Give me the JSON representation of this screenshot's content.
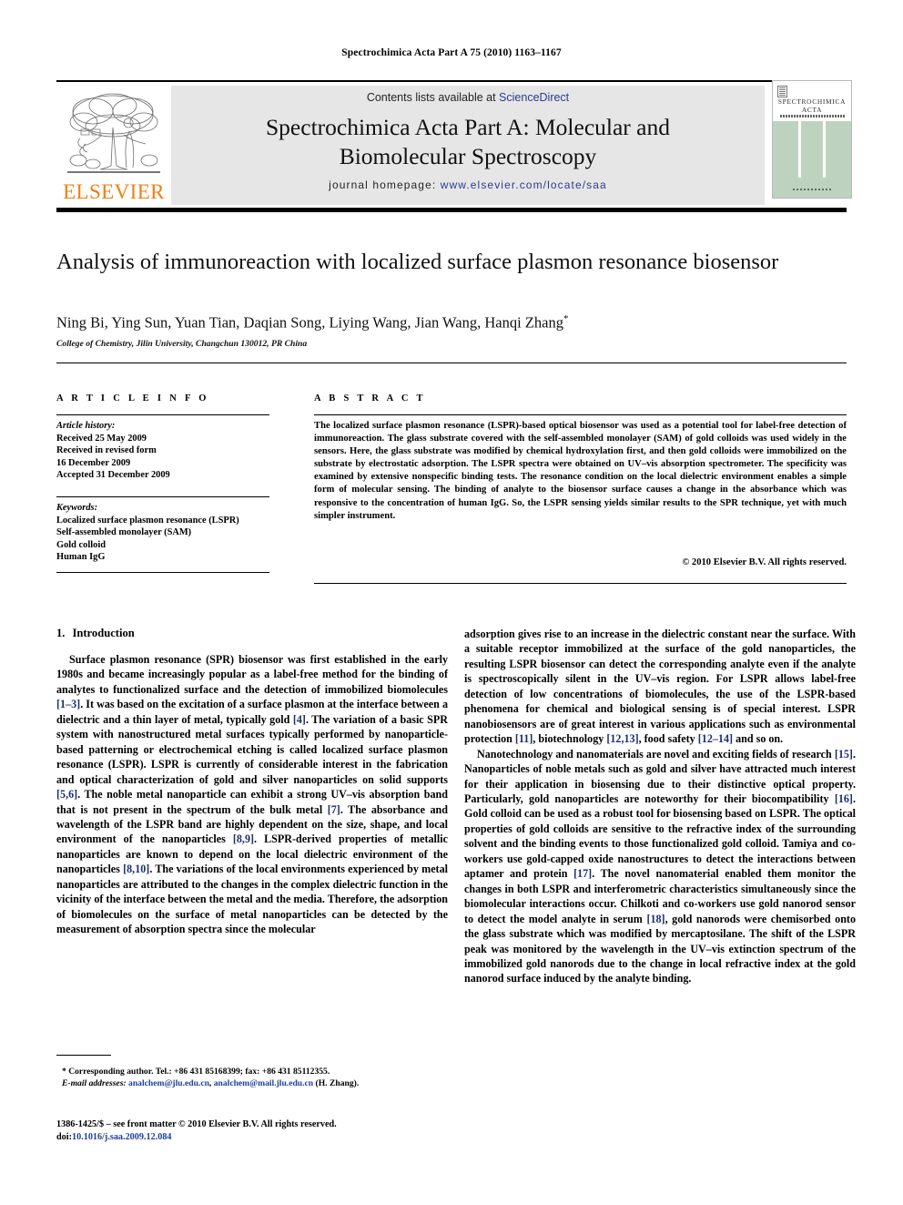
{
  "running_head": "Spectrochimica Acta Part A 75 (2010) 1163–1167",
  "masthead": {
    "contents_prefix": "Contents lists available at ",
    "contents_link": "ScienceDirect",
    "journal_title_line1": "Spectrochimica Acta Part A: Molecular and",
    "journal_title_line2": "Biomolecular Spectroscopy",
    "homepage_prefix": "journal homepage: ",
    "homepage_url": "www.elsevier.com/locate/saa",
    "publisher_logo_text": "ELSEVIER",
    "publisher_logo_icon": "elsevier-tree-icon",
    "accent_orange": "#f07f13",
    "link_blue": "#2a3b8f",
    "band_gray": "#e6e6e6"
  },
  "cover": {
    "title_line1": "SPECTROCHIMICA",
    "title_line2": "ACTA",
    "body_color": "#bed3bf"
  },
  "article": {
    "title": "Analysis of immunoreaction with localized surface plasmon resonance biosensor",
    "authors": "Ning Bi, Ying Sun, Yuan Tian, Daqian Song, Liying Wang, Jian Wang, Hanqi Zhang",
    "corresponding_marker": "*",
    "affiliation": "College of Chemistry, Jilin University, Changchun 130012, PR China"
  },
  "article_info": {
    "heading": "A R T I C L E   I N F O",
    "history_label": "Article history:",
    "history": [
      "Received 25 May 2009",
      "Received in revised form",
      "16 December 2009",
      "Accepted 31 December 2009"
    ],
    "keywords_label": "Keywords:",
    "keywords": [
      "Localized surface plasmon resonance (LSPR)",
      "Self-assembled monolayer (SAM)",
      "Gold colloid",
      "Human IgG"
    ]
  },
  "abstract": {
    "heading": "A B S T R A C T",
    "text": "The localized surface plasmon resonance (LSPR)-based optical biosensor was used as a potential tool for label-free detection of immunoreaction. The glass substrate covered with the self-assembled monolayer (SAM) of gold colloids was used widely in the sensors. Here, the glass substrate was modified by chemical hydroxylation first, and then gold colloids were immobilized on the substrate by electrostatic adsorption. The LSPR spectra were obtained on UV–vis absorption spectrometer. The specificity was examined by extensive nonspecific binding tests. The resonance condition on the local dielectric environment enables a simple form of molecular sensing. The binding of analyte to the biosensor surface causes a change in the absorbance which was responsive to the concentration of human IgG. So, the LSPR sensing yields similar results to the SPR technique, yet with much simpler instrument.",
    "copyright": "© 2010 Elsevier B.V. All rights reserved."
  },
  "body": {
    "section_number": "1.",
    "section_title": "Introduction",
    "left_paragraph_1_parts": [
      "Surface plasmon resonance (SPR) biosensor was first established in the early 1980s and became increasingly popular as a label-free method for the binding of analytes to functionalized surface and the detection of immobilized biomolecules ",
      "[1–3]",
      ". It was based on the excitation of a surface plasmon at the interface between a dielectric and a thin layer of metal, typically gold ",
      "[4]",
      ". The variation of a basic SPR system with nanostructured metal surfaces typically performed by nanoparticle-based patterning or electrochemical etching is called localized surface plasmon resonance (LSPR). LSPR is currently of considerable interest in the fabrication and optical characterization of gold and silver nanoparticles on solid supports ",
      "[5,6]",
      ". The noble metal nanoparticle can exhibit a strong UV–vis absorption band that is not present in the spectrum of the bulk metal ",
      "[7]",
      ". The absorbance and wavelength of the LSPR band are highly dependent on the size, shape, and local environment of the nanoparticles ",
      "[8,9]",
      ". LSPR-derived properties of metallic nanoparticles are known to depend on the local dielectric environment of the nanoparticles ",
      "[8,10]",
      ". The variations of the local environments experienced by metal nanoparticles are attributed to the changes in the complex dielectric function in the vicinity of the interface between the metal and the media. Therefore, the adsorption of biomolecules on the surface of metal nanoparticles can be detected by the measurement of absorption spectra since the molecular"
    ],
    "right_paragraph_1_parts": [
      "adsorption gives rise to an increase in the dielectric constant near the surface. With a suitable receptor immobilized at the surface of the gold nanoparticles, the resulting LSPR biosensor can detect the corresponding analyte even if the analyte is spectroscopically silent in the UV–vis region. For LSPR allows label-free detection of low concentrations of biomolecules, the use of the LSPR-based phenomena for chemical and biological sensing is of special interest. LSPR nanobiosensors are of great interest in various applications such as environmental protection ",
      "[11]",
      ", biotechnology ",
      "[12,13]",
      ", food safety ",
      "[12–14]",
      " and so on."
    ],
    "right_paragraph_2_parts": [
      "Nanotechnology and nanomaterials are novel and exciting fields of research ",
      "[15]",
      ". Nanoparticles of noble metals such as gold and silver have attracted much interest for their application in biosensing due to their distinctive optical property. Particularly, gold nanoparticles are noteworthy for their biocompatibility ",
      "[16]",
      ". Gold colloid can be used as a robust tool for biosensing based on LSPR. The optical properties of gold colloids are sensitive to the refractive index of the surrounding solvent and the binding events to those functionalized gold colloid. Tamiya and co-workers use gold-capped oxide nanostructures to detect the interactions between aptamer and protein ",
      "[17]",
      ". The novel nanomaterial enabled them monitor the changes in both LSPR and interferometric characteristics simultaneously since the biomolecular interactions occur. Chilkoti and co-workers use gold nanorod sensor to detect the model analyte in serum ",
      "[18]",
      ", gold nanorods were chemisorbed onto the glass substrate which was modified by mercaptosilane. The shift of the LSPR peak was monitored by the wavelength in the UV–vis extinction spectrum of the immobilized gold nanorods due to the change in local refractive index at the gold nanorod surface induced by the analyte binding."
    ]
  },
  "footnotes": {
    "corresponding": "* Corresponding author. Tel.: +86 431 85168399; fax: +86 431 85112355.",
    "email_label": "E-mail addresses:",
    "email_1": "analchem@jlu.edu.cn",
    "email_2": "analchem@mail.jlu.edu.cn",
    "email_suffix": "(H. Zhang).",
    "issn_line": "1386-1425/$ – see front matter © 2010 Elsevier B.V. All rights reserved.",
    "doi_label": "doi:",
    "doi_value": "10.1016/j.saa.2009.12.084"
  }
}
